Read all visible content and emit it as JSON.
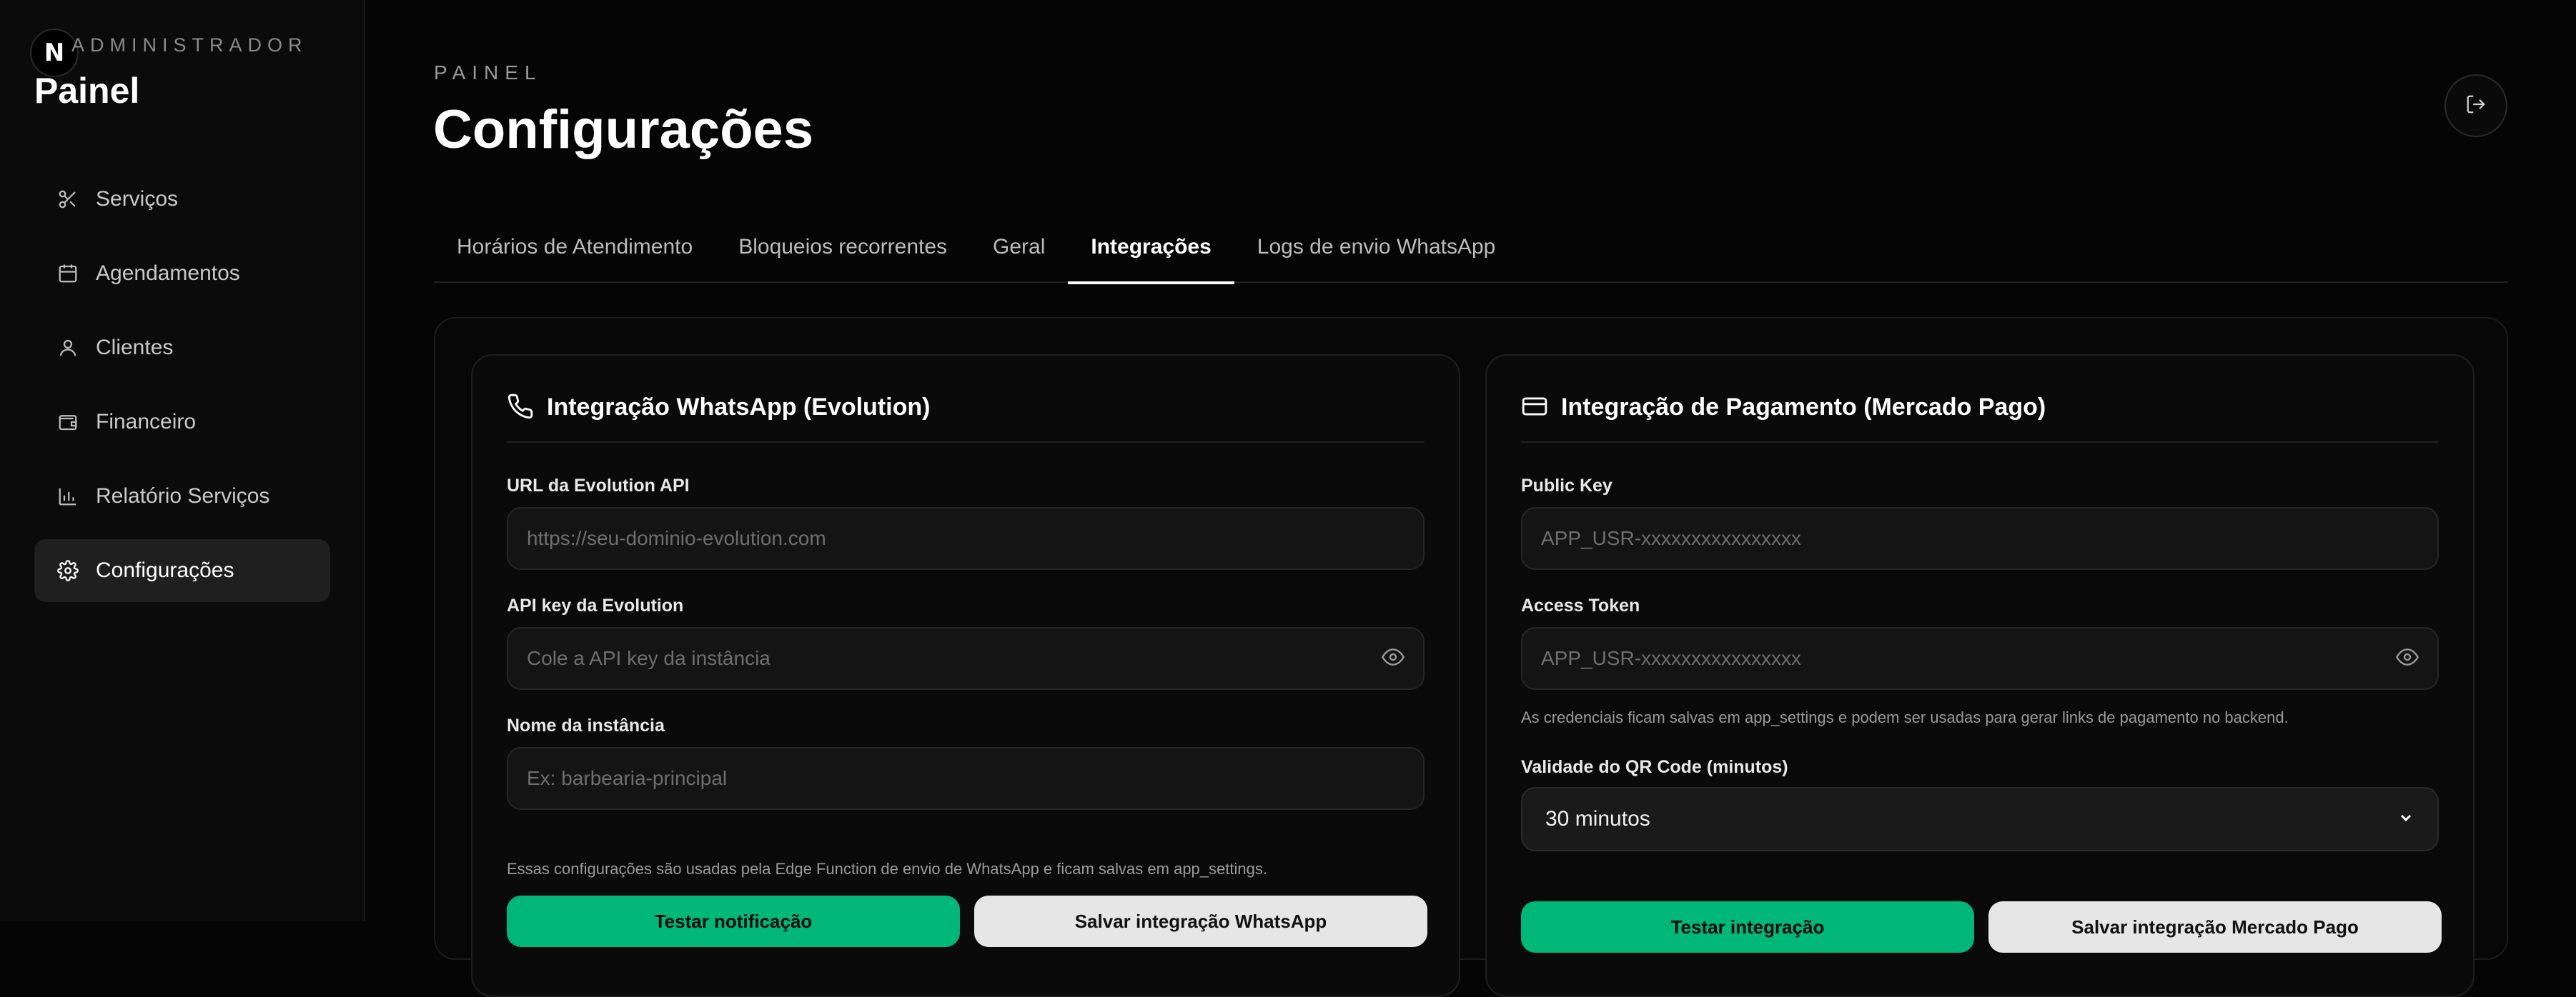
{
  "sidebar": {
    "logo_letter": "N",
    "admin_label": "ADMINISTRADOR",
    "title": "Painel",
    "items": [
      {
        "label": "Serviços",
        "icon": "scissors-icon"
      },
      {
        "label": "Agendamentos",
        "icon": "calendar-icon"
      },
      {
        "label": "Clientes",
        "icon": "user-icon"
      },
      {
        "label": "Financeiro",
        "icon": "wallet-icon"
      },
      {
        "label": "Relatório Serviços",
        "icon": "bar-chart-icon"
      },
      {
        "label": "Configurações",
        "icon": "gear-icon",
        "active": true
      }
    ]
  },
  "header": {
    "eyebrow": "PAINEL",
    "title": "Configurações",
    "logout_icon": "logout-icon"
  },
  "tabs": [
    {
      "label": "Horários de Atendimento"
    },
    {
      "label": "Bloqueios recorrentes"
    },
    {
      "label": "Geral"
    },
    {
      "label": "Integrações",
      "active": true
    },
    {
      "label": "Logs de envio WhatsApp"
    }
  ],
  "whatsapp": {
    "title": "Integração WhatsApp (Evolution)",
    "icon": "phone-icon",
    "url_label": "URL da Evolution API",
    "url_placeholder": "https://seu-dominio-evolution.com",
    "url_value": "",
    "apikey_label": "API key da Evolution",
    "apikey_placeholder": "Cole a API key da instância",
    "apikey_value": "",
    "instance_label": "Nome da instância",
    "instance_placeholder": "Ex: barbearia-principal",
    "instance_value": "",
    "hint": "Essas configurações são usadas pela Edge Function de envio de WhatsApp e ficam salvas em app_settings.",
    "test_button": "Testar notificação",
    "save_button": "Salvar integração WhatsApp"
  },
  "payment": {
    "title": "Integração de Pagamento (Mercado Pago)",
    "icon": "credit-card-icon",
    "public_key_label": "Public Key",
    "public_key_placeholder": "APP_USR-xxxxxxxxxxxxxxxx",
    "public_key_value": "",
    "access_token_label": "Access Token",
    "access_token_placeholder": "APP_USR-xxxxxxxxxxxxxxxx",
    "access_token_value": "",
    "hint": "As credenciais ficam salvas em app_settings e podem ser usadas para gerar links de pagamento no backend.",
    "qr_label": "Validade do QR Code (minutos)",
    "qr_value": "30 minutos",
    "test_button": "Testar integração",
    "save_button": "Salvar integração Mercado Pago"
  },
  "colors": {
    "accent": "#00b77a",
    "background": "#050505",
    "surface": "#0a0a0a"
  }
}
